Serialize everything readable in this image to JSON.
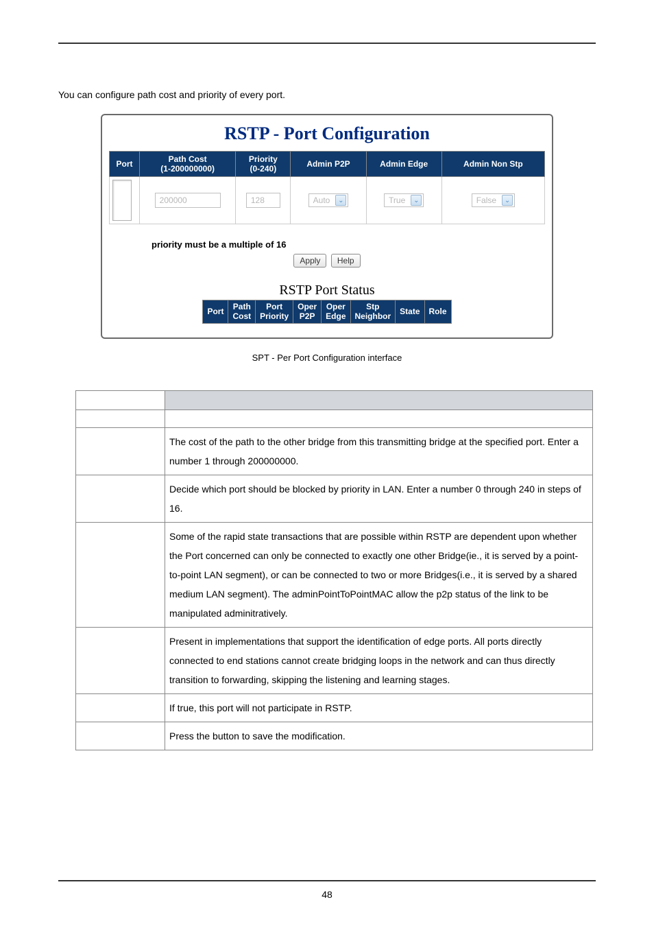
{
  "page": {
    "intro": "You can configure path cost and priority of every port.",
    "caption": "SPT - Per Port Configuration interface",
    "number": "48"
  },
  "screenshot": {
    "title": "RSTP - Port Configuration",
    "config_headers": {
      "port": "Port",
      "path_cost": "Path Cost",
      "path_cost_range": "(1-200000000)",
      "priority": "Priority",
      "priority_range": "(0-240)",
      "admin_p2p": "Admin P2P",
      "admin_edge": "Admin Edge",
      "admin_non_stp": "Admin Non Stp"
    },
    "config_row": {
      "path_cost_value": "200000",
      "priority_value": "128",
      "admin_p2p_value": "Auto",
      "admin_edge_value": "True",
      "admin_non_stp_value": "False"
    },
    "priority_note": "priority must be a multiple of 16",
    "buttons": {
      "apply": "Apply",
      "help": "Help"
    },
    "status_title": "RSTP Port Status",
    "status_headers": {
      "port": "Port",
      "path_cost": "Path\nCost",
      "port_priority": "Port\nPriority",
      "oper_p2p": "Oper\nP2P",
      "oper_edge": "Oper\nEdge",
      "stp_neighbor": "Stp\nNeighbor",
      "state": "State",
      "role": "Role"
    }
  },
  "description_table": {
    "rows": [
      {
        "label": "",
        "desc": "The cost of the path to the other bridge from this transmitting bridge at the specified port. Enter a number 1 through 200000000."
      },
      {
        "label": "",
        "desc": "Decide which port should be blocked by priority in LAN. Enter a number 0 through 240 in steps of 16."
      },
      {
        "label": "",
        "desc": "Some of the rapid state transactions that are possible within RSTP are dependent upon whether the Port concerned can only be connected to exactly one other Bridge(ie., it is served by a point-to-point LAN segment), or can be connected to two or more Bridges(i.e., it is served by a shared medium LAN segment). The adminPointToPointMAC allow the p2p status of the link to be manipulated adminitratively."
      },
      {
        "label": "",
        "desc": "Present in implementations that support the identification of edge ports. All ports directly connected to end stations cannot create bridging loops in the network and can thus directly transition to forwarding, skipping the listening and learning stages."
      },
      {
        "label": "",
        "desc": "If true, this port will not participate in RSTP."
      },
      {
        "label": "",
        "desc": "Press the button to save the modification."
      }
    ]
  }
}
